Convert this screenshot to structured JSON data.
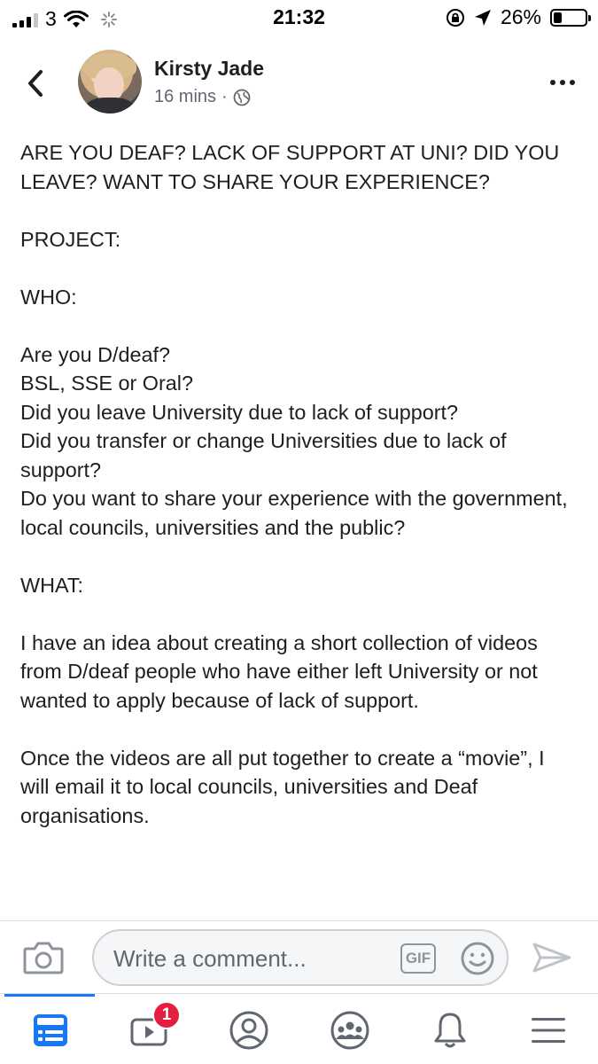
{
  "status_bar": {
    "carrier": "3",
    "time": "21:32",
    "battery_percent": "26%",
    "battery_level": 0.26,
    "icons": [
      "signal-icon",
      "wifi-icon",
      "activity-spinner-icon",
      "orientation-lock-icon",
      "location-arrow-icon",
      "battery-icon"
    ]
  },
  "post": {
    "author": "Kirsty Jade",
    "timestamp": "16 mins",
    "separator": "·",
    "privacy_icon": "globe-icon",
    "paragraphs": [
      "ARE YOU DEAF? LACK OF SUPPORT AT UNI? DID YOU LEAVE? WANT TO SHARE YOUR EXPERIENCE?",
      "PROJECT:",
      "WHO:",
      "Are you D/deaf?",
      "BSL, SSE or Oral?",
      "Did you leave University due to lack of support?",
      "Did you transfer or change Universities due to lack of support?",
      "Do you want to share your experience with the government, local councils, universities and the public?",
      "WHAT:",
      "I have an idea about creating a short collection of videos from D/deaf people who have either left University or not wanted to apply because of lack of support.",
      "Once the videos are all put together to create a “movie”, I will email it to local councils, universities and Deaf organisations."
    ]
  },
  "comment_bar": {
    "placeholder": "Write a comment...",
    "gif_label": "GIF"
  },
  "bottom_nav": {
    "items": [
      "news-feed-icon",
      "watch-icon",
      "profile-icon",
      "groups-icon",
      "notifications-icon",
      "menu-icon"
    ],
    "watch_badge": "1",
    "active_color": "#1877f2"
  }
}
